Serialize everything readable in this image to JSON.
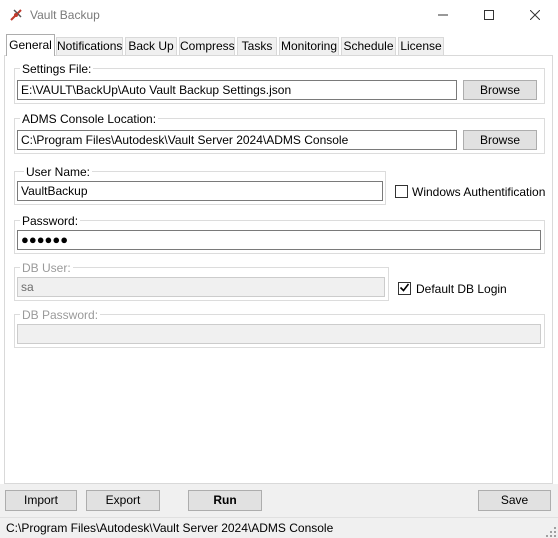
{
  "window": {
    "title": "Vault Backup",
    "icon": "vault-backup-icon",
    "controls": [
      "minimize-icon",
      "maximize-icon",
      "close-icon"
    ]
  },
  "tabs": [
    "General",
    "Notifications",
    "Back Up",
    "Compress",
    "Tasks",
    "Monitoring",
    "Schedule",
    "License"
  ],
  "active_tab": "General",
  "settings_file": {
    "label": "Settings File:",
    "value": "E:\\VAULT\\BackUp\\Auto Vault Backup Settings.json",
    "browse_label": "Browse"
  },
  "adms_console": {
    "label": "ADMS Console Location:",
    "value": "C:\\Program Files\\Autodesk\\Vault Server 2024\\ADMS Console",
    "browse_label": "Browse"
  },
  "user_name": {
    "label": "User Name:",
    "value": "VaultBackup"
  },
  "windows_auth": {
    "label": "Windows Authentification",
    "checked": false
  },
  "password": {
    "label": "Password:",
    "value": "●●●●●●"
  },
  "db_user": {
    "label": "DB User:",
    "value": "sa",
    "enabled": false
  },
  "default_db_login": {
    "label": "Default DB Login",
    "checked": true
  },
  "db_password": {
    "label": "DB Password:",
    "value": "",
    "enabled": false
  },
  "actions": {
    "import_label": "Import",
    "export_label": "Export",
    "run_label": "Run",
    "save_label": "Save"
  },
  "status": {
    "text": "C:\\Program Files\\Autodesk\\Vault Server 2024\\ADMS Console"
  },
  "colors": {
    "button_bg": "#e1e1e1",
    "disabled_text": "#9a9a9a",
    "chrome_bg": "#f0f0f0"
  }
}
